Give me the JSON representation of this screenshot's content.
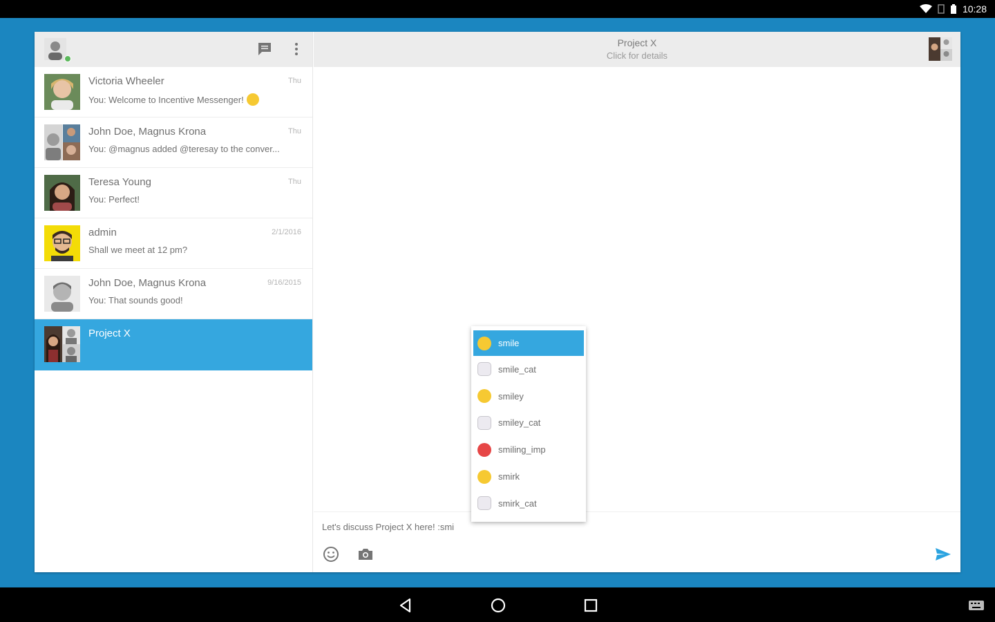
{
  "status_bar": {
    "time": "10:28"
  },
  "sidebar": {
    "conversations": [
      {
        "name": "Victoria Wheeler",
        "date": "Thu",
        "preview": "You: Welcome to Incentive Messenger!",
        "avatar_color": "#c9a57d"
      },
      {
        "name": "John Doe, Magnus Krona",
        "date": "Thu",
        "preview": "You: @magnus added @teresay to the conver...",
        "avatar_color": "#9d9d9d"
      },
      {
        "name": "Teresa Young",
        "date": "Thu",
        "preview": "You: Perfect!",
        "avatar_color": "#8b6a52"
      },
      {
        "name": "admin",
        "date": "2/1/2016",
        "preview": "Shall we meet at 12 pm?",
        "avatar_color": "#f2d800"
      },
      {
        "name": "John Doe, Magnus Krona",
        "date": "9/16/2015",
        "preview": "You: That sounds good!",
        "avatar_color": "#b5b5b5"
      },
      {
        "name": "Project X",
        "date": "",
        "preview": "",
        "avatar_color": "#6d4a3a"
      }
    ]
  },
  "chat": {
    "title": "Project X",
    "subtitle": "Click for details",
    "composer_value": "Let's discuss Project X here! :smi"
  },
  "suggestions": [
    {
      "label": "smile",
      "icon": "smile-emoji-icon",
      "kind": "yellow"
    },
    {
      "label": "smile_cat",
      "icon": "smile-cat-emoji-icon",
      "kind": "cat"
    },
    {
      "label": "smiley",
      "icon": "smiley-emoji-icon",
      "kind": "yellow"
    },
    {
      "label": "smiley_cat",
      "icon": "smiley-cat-emoji-icon",
      "kind": "cat"
    },
    {
      "label": "smiling_imp",
      "icon": "smiling-imp-emoji-icon",
      "kind": "red"
    },
    {
      "label": "smirk",
      "icon": "smirk-emoji-icon",
      "kind": "yellow"
    },
    {
      "label": "smirk_cat",
      "icon": "smirk-cat-emoji-icon",
      "kind": "cat"
    }
  ],
  "colors": {
    "accent": "#35a7df",
    "background": "#1b86c0",
    "send": "#2aa3e0"
  }
}
